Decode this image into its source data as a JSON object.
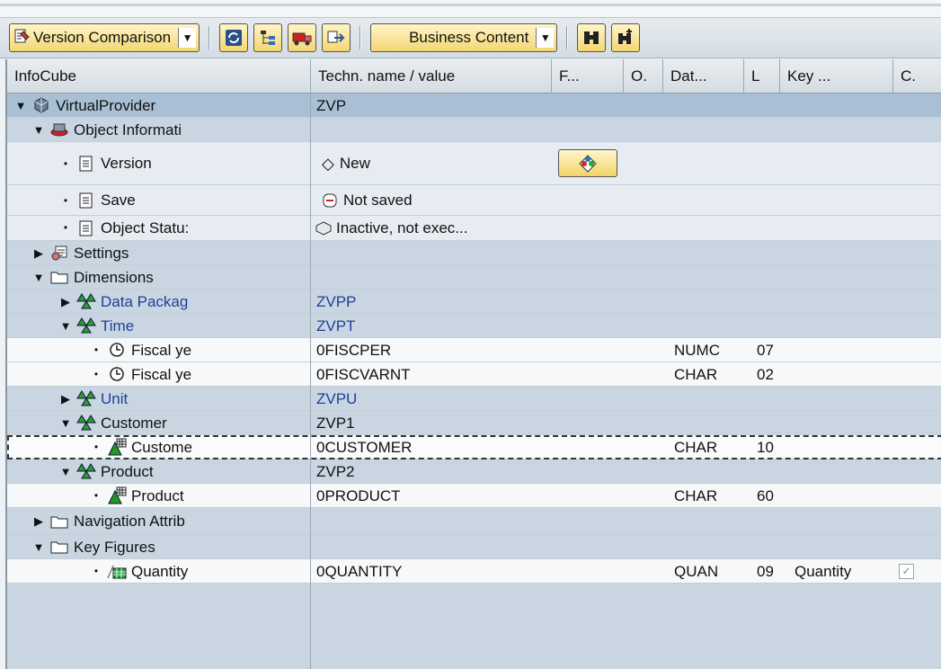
{
  "toolbar": {
    "version_dropdown": "Version Comparison",
    "business_dropdown": "Business Content",
    "icons": [
      "refresh-icon",
      "hierarchy-icon",
      "transport-icon",
      "exchange-icon",
      "find-icon",
      "find-next-icon"
    ]
  },
  "columns": [
    "InfoCube",
    "Techn. name / value",
    "F...",
    "O.",
    "Dat...",
    "L",
    "Key ...",
    "C."
  ],
  "rows": [
    {
      "name": "VirtualProvider",
      "value": "ZVP"
    },
    {
      "name": "Object Informati",
      "value": ""
    },
    {
      "name": "Version",
      "value": "New"
    },
    {
      "name": "Save",
      "value": "Not saved"
    },
    {
      "name": "Object Statu:",
      "value": "Inactive, not exec..."
    },
    {
      "name": "Settings",
      "value": ""
    },
    {
      "name": "Dimensions",
      "value": ""
    },
    {
      "name": "Data Packag",
      "value": "ZVPP"
    },
    {
      "name": "Time",
      "value": "ZVPT"
    },
    {
      "name": "Fiscal ye",
      "value": "0FISCPER",
      "datatype": "NUMC",
      "length": "07"
    },
    {
      "name": "Fiscal ye",
      "value": "0FISCVARNT",
      "datatype": "CHAR",
      "length": "02"
    },
    {
      "name": "Unit",
      "value": "ZVPU"
    },
    {
      "name": "Customer",
      "value": "ZVP1"
    },
    {
      "name": "Custome",
      "value": "0CUSTOMER",
      "datatype": "CHAR",
      "length": "10"
    },
    {
      "name": "Product",
      "value": "ZVP2"
    },
    {
      "name": "Product",
      "value": "0PRODUCT",
      "datatype": "CHAR",
      "length": "60"
    },
    {
      "name": "Navigation Attrib",
      "value": ""
    },
    {
      "name": "Key Figures",
      "value": ""
    },
    {
      "name": "Quantity",
      "value": "0QUANTITY",
      "datatype": "QUAN",
      "length": "09",
      "key": "Quantity"
    }
  ]
}
